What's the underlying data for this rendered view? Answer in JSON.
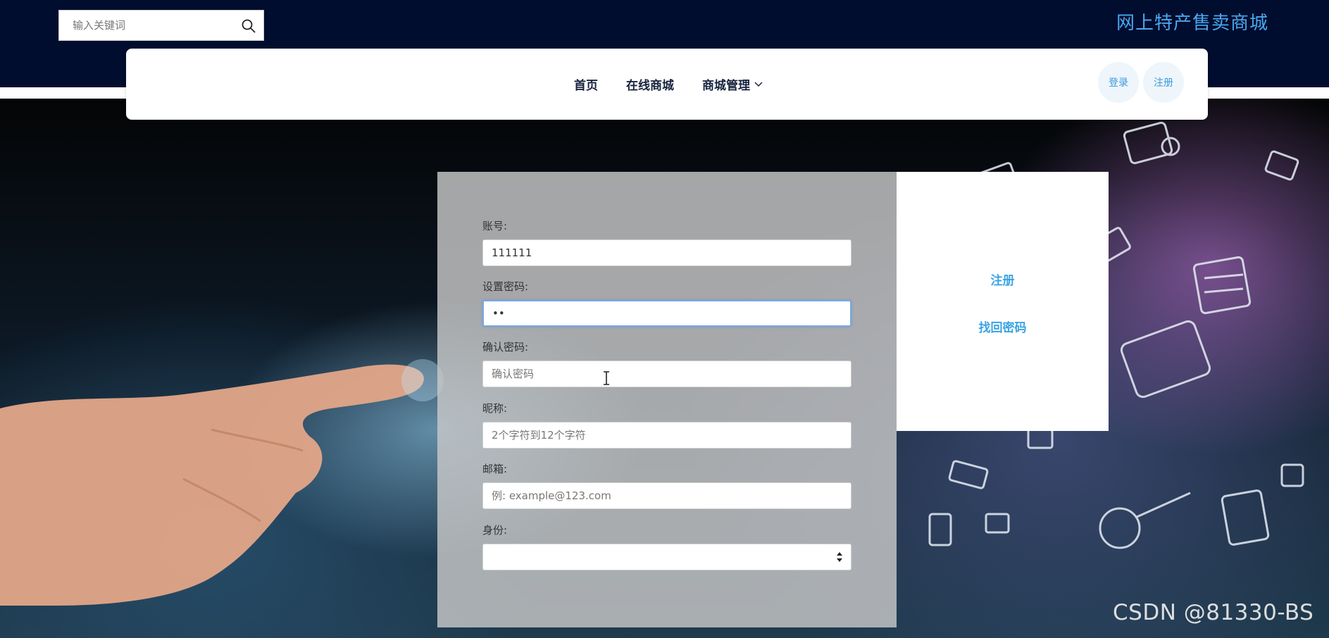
{
  "header": {
    "search_placeholder": "输入关键词",
    "site_title": "网上特产售卖商城"
  },
  "nav": {
    "links": [
      "首页",
      "在线商城",
      "商城管理"
    ],
    "login_label": "登录",
    "register_label": "注册"
  },
  "form": {
    "account_label": "账号:",
    "account_value": "111111",
    "password_label": "设置密码:",
    "password_value": "••",
    "confirm_label": "确认密码:",
    "confirm_placeholder": "确认密码",
    "nickname_label": "昵称:",
    "nickname_placeholder": "2个字符到12个字符",
    "email_label": "邮箱:",
    "email_placeholder": "例: example@123.com",
    "role_label": "身份:",
    "role_value": ""
  },
  "side": {
    "register_link": "注册",
    "recover_link": "找回密码"
  },
  "watermark": "CSDN @81330-BS",
  "colors": {
    "topbar": "#000d2e",
    "accent": "#3aa3e3",
    "title": "#4aa7f0"
  }
}
